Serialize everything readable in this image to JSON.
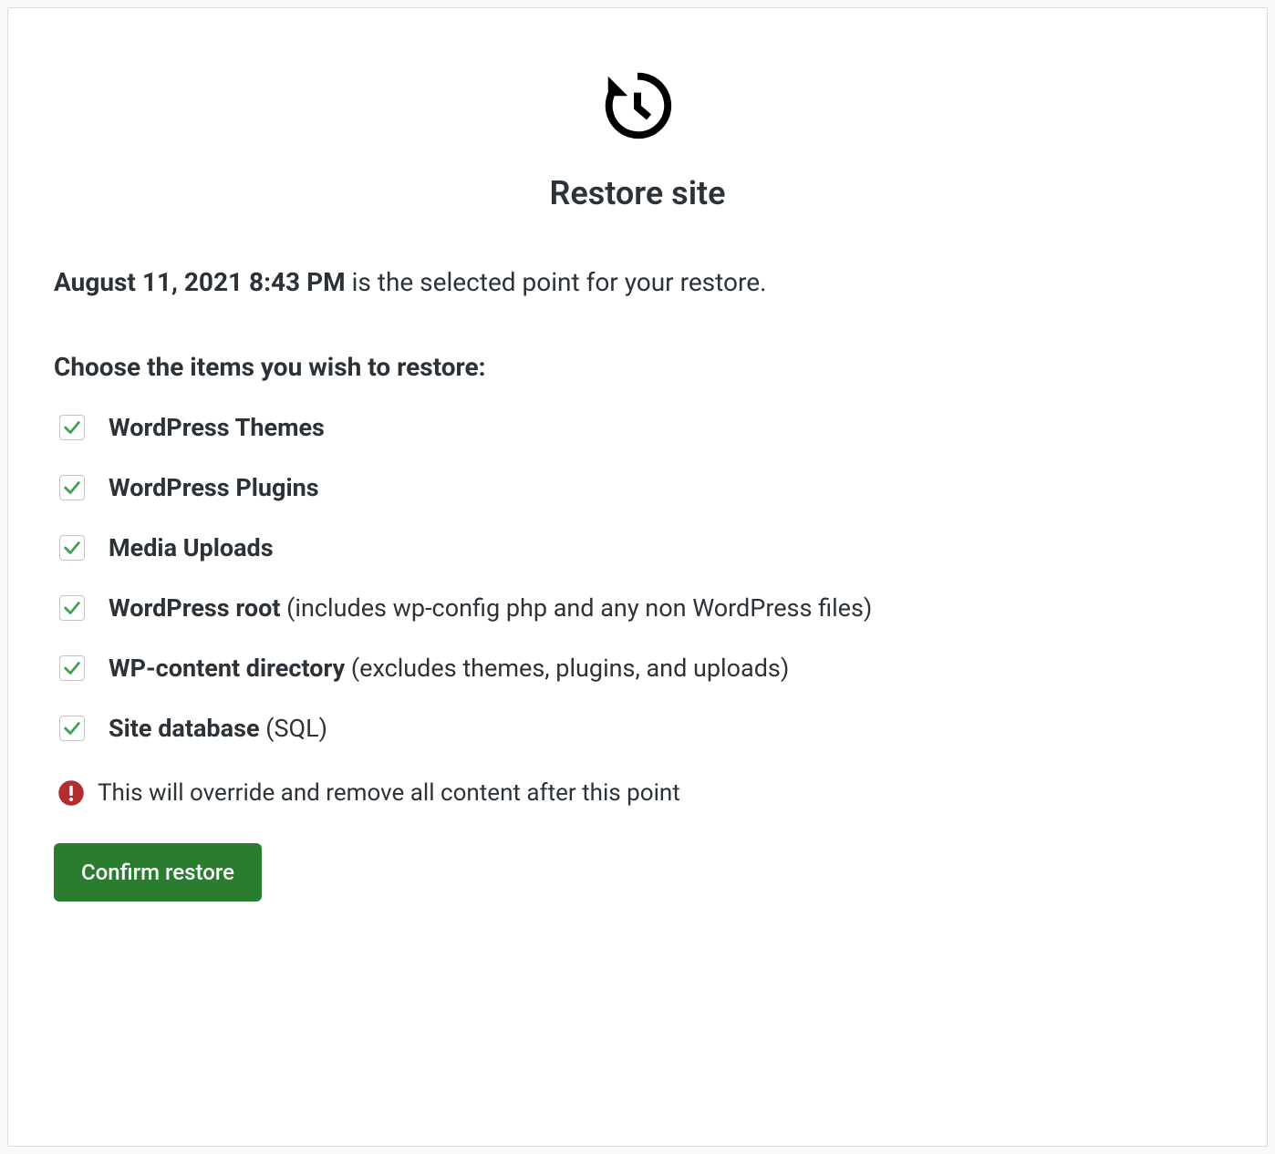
{
  "header": {
    "title": "Restore site"
  },
  "restore": {
    "timestamp": "August 11, 2021 8:43 PM",
    "timestamp_suffix": " is the selected point for your restore.",
    "choose_label": "Choose the items you wish to restore:",
    "warning_text": "This will override and remove all content after this point",
    "confirm_button_label": "Confirm restore",
    "items": [
      {
        "label": "WordPress Themes",
        "note": "",
        "checked": true
      },
      {
        "label": "WordPress Plugins",
        "note": "",
        "checked": true
      },
      {
        "label": "Media Uploads",
        "note": "",
        "checked": true
      },
      {
        "label": "WordPress root",
        "note": " (includes wp-config php and any non WordPress files)",
        "checked": true
      },
      {
        "label": "WP-content directory",
        "note": " (excludes themes, plugins, and uploads)",
        "checked": true
      },
      {
        "label": "Site database",
        "note": " (SQL)",
        "checked": true
      }
    ]
  },
  "colors": {
    "accent_green": "#2a7d2e",
    "check_green": "#3fa34d",
    "warning_red": "#b32d2e",
    "text": "#2c3338",
    "border": "#dcdcde"
  }
}
